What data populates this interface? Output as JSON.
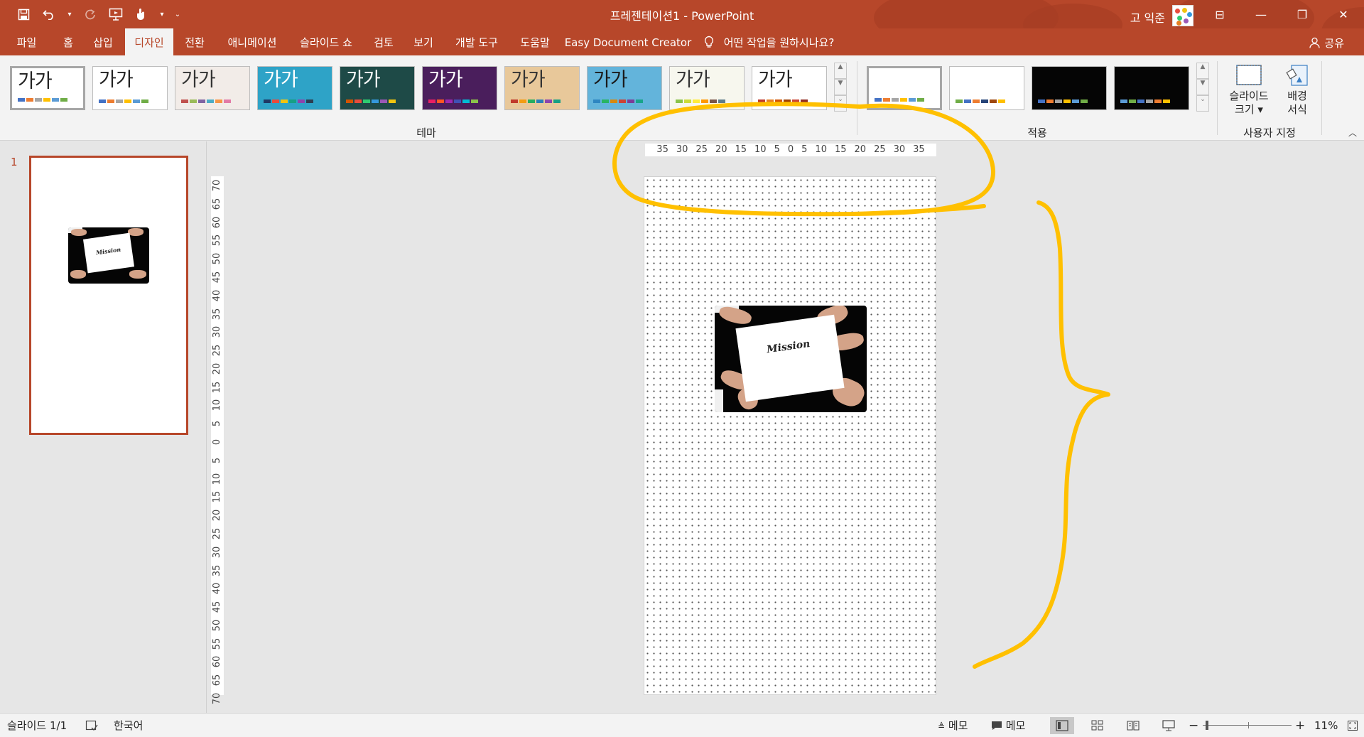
{
  "window": {
    "title": "프레젠테이션1  -  PowerPoint",
    "user_name": "고 익준",
    "controls": {
      "ribbon_display": "⊟",
      "minimize": "—",
      "restore": "❐",
      "close": "✕"
    }
  },
  "quick_access": {
    "save": "save-icon",
    "undo": "undo-icon",
    "redo": "redo-icon",
    "present": "present-icon",
    "touch": "touch-mode-icon",
    "customize": "customize-icon"
  },
  "tabs": [
    {
      "label": "파일"
    },
    {
      "label": "홈"
    },
    {
      "label": "삽입"
    },
    {
      "label": "디자인",
      "active": true
    },
    {
      "label": "전환"
    },
    {
      "label": "애니메이션"
    },
    {
      "label": "슬라이드 쇼"
    },
    {
      "label": "검토"
    },
    {
      "label": "보기"
    },
    {
      "label": "개발 도구"
    },
    {
      "label": "도움말"
    },
    {
      "label": "Easy Document Creator"
    }
  ],
  "tell_me": "어떤 작업을 원하시나요?",
  "share": "공유",
  "ribbon": {
    "themes_group_label": "테마",
    "variants_group_label": "적용",
    "customize_group_label": "사용자 지정",
    "theme_sample_text": "가가",
    "slide_size": {
      "line1": "슬라이드",
      "line2": "크기"
    },
    "format_background": {
      "line1": "배경",
      "line2": "서식"
    },
    "themes": [
      {
        "bg": "#ffffff",
        "text": "#222222",
        "swatches": [
          "#4472c4",
          "#ed7d31",
          "#a5a5a5",
          "#ffc000",
          "#5b9bd5",
          "#70ad47"
        ]
      },
      {
        "bg": "#ffffff",
        "text": "#222222",
        "swatches": [
          "#4472c4",
          "#ed7d31",
          "#a5a5a5",
          "#ffc000",
          "#5b9bd5",
          "#70ad47"
        ]
      },
      {
        "bg": "#f2ece8",
        "text": "#333333",
        "swatches": [
          "#c0504d",
          "#9bbb59",
          "#8064a2",
          "#4bacc6",
          "#f79646",
          "#e27aa6"
        ]
      },
      {
        "bg": "#2ea3c7",
        "text": "#ffffff",
        "swatches": [
          "#1f3864",
          "#e84c3d",
          "#f1c40f",
          "#16a085",
          "#8e44ad",
          "#2c3e50"
        ]
      },
      {
        "bg": "#1e4a47",
        "text": "#ffffff",
        "swatches": [
          "#d35400",
          "#e74c3c",
          "#2ecc71",
          "#3498db",
          "#9b59b6",
          "#f1c40f"
        ]
      },
      {
        "bg": "#4a1e5c",
        "text": "#ffffff",
        "swatches": [
          "#e91e63",
          "#ff5722",
          "#9c27b0",
          "#3f51b5",
          "#00bcd4",
          "#8bc34a"
        ]
      },
      {
        "bg": "#e8c89a",
        "text": "#333333",
        "swatches": [
          "#c0392b",
          "#f39c12",
          "#27ae60",
          "#2980b9",
          "#8e44ad",
          "#16a085"
        ]
      },
      {
        "bg": "#63b4db",
        "text": "#1a1a1a",
        "swatches": [
          "#2e86c1",
          "#28b463",
          "#d68910",
          "#cb4335",
          "#7d3c98",
          "#17a589"
        ]
      },
      {
        "bg": "#f7f7ee",
        "text": "#333333",
        "swatches": [
          "#8bc34a",
          "#cddc39",
          "#ffeb3b",
          "#ff9800",
          "#795548",
          "#607d8b"
        ]
      },
      {
        "bg": "#ffffff",
        "text": "#222222",
        "swatches": [
          "#c0392b",
          "#e67e22",
          "#d35400",
          "#a04000",
          "#cb4335",
          "#922b21"
        ]
      }
    ],
    "variants": [
      {
        "bg": "#ffffff",
        "swatches": [
          "#4472c4",
          "#ed7d31",
          "#a5a5a5",
          "#ffc000",
          "#5b9bd5",
          "#70ad47"
        ]
      },
      {
        "bg": "#ffffff",
        "swatches": [
          "#70ad47",
          "#4472c4",
          "#ed7d31",
          "#264478",
          "#9e480e",
          "#ffc000"
        ]
      },
      {
        "bg": "#050505",
        "swatches": [
          "#4472c4",
          "#ed7d31",
          "#a5a5a5",
          "#ffc000",
          "#5b9bd5",
          "#70ad47"
        ]
      },
      {
        "bg": "#050505",
        "swatches": [
          "#5b9bd5",
          "#70ad47",
          "#4472c4",
          "#a5a5a5",
          "#ed7d31",
          "#ffc000"
        ]
      }
    ]
  },
  "slides_pane": {
    "slide_number": "1"
  },
  "rulers": {
    "horizontal": [
      "35",
      "30",
      "25",
      "20",
      "15",
      "10",
      "5",
      "0",
      "5",
      "10",
      "15",
      "20",
      "25",
      "30",
      "35"
    ],
    "vertical": [
      "70",
      "65",
      "60",
      "55",
      "50",
      "45",
      "40",
      "35",
      "30",
      "25",
      "20",
      "15",
      "10",
      "5",
      "0",
      "5",
      "10",
      "15",
      "20",
      "25",
      "30",
      "35",
      "40",
      "45",
      "50",
      "55",
      "60",
      "65",
      "70"
    ]
  },
  "slide": {
    "image_caption": "Mission"
  },
  "statusbar": {
    "slide_info": "슬라이드 1/1",
    "language": "한국어",
    "notes": "메모",
    "comments": "메모",
    "zoom": "11%",
    "zoom_out": "−",
    "zoom_in": "+"
  },
  "colors": {
    "accent": "#b7472a",
    "annotation": "#ffc000"
  }
}
